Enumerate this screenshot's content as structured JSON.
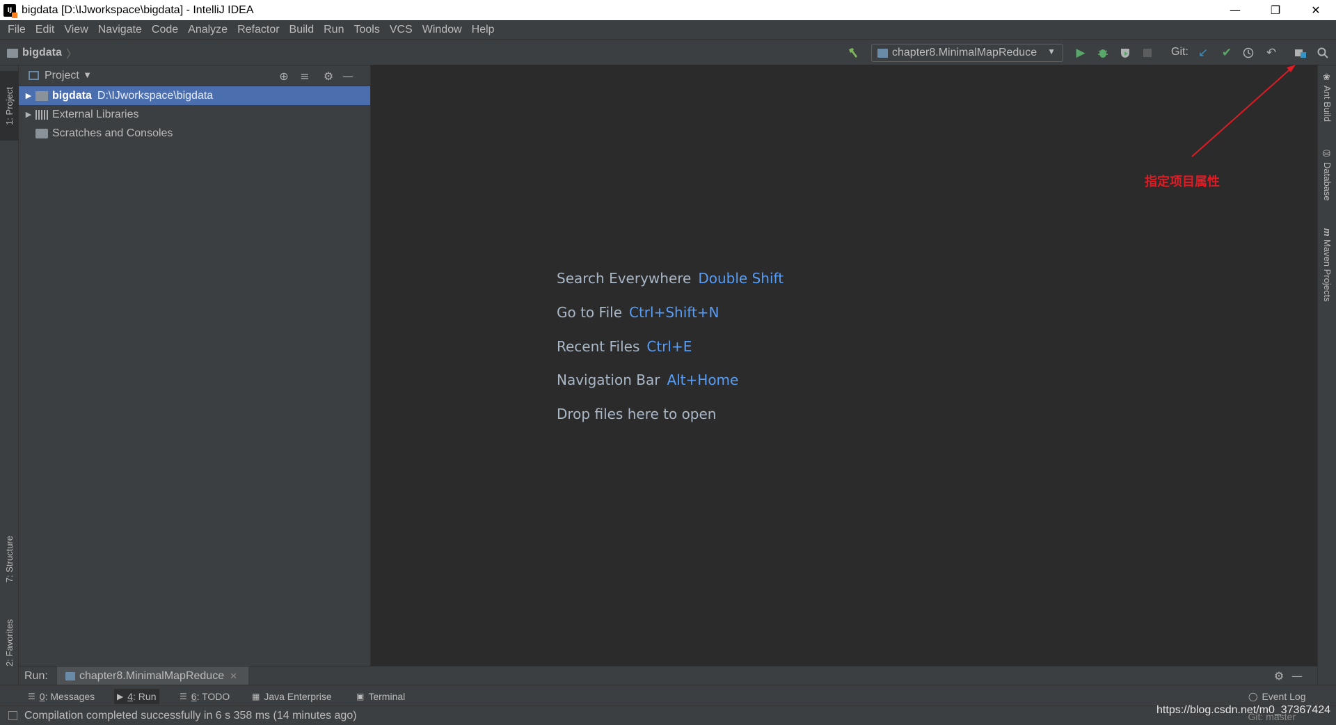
{
  "window": {
    "title": "bigdata [D:\\IJworkspace\\bigdata] - IntelliJ IDEA",
    "app_icon": "intellij-icon",
    "controls": [
      "minimize",
      "restore",
      "close"
    ]
  },
  "menu": [
    {
      "label": "File"
    },
    {
      "label": "Edit"
    },
    {
      "label": "View"
    },
    {
      "label": "Navigate"
    },
    {
      "label": "Code"
    },
    {
      "label": "Analyze"
    },
    {
      "label": "Refactor"
    },
    {
      "label": "Build"
    },
    {
      "label": "Run"
    },
    {
      "label": "Tools"
    },
    {
      "label": "VCS"
    },
    {
      "label": "Window"
    },
    {
      "label": "Help"
    }
  ],
  "navbar": {
    "breadcrumb": "bigdata",
    "run_config": "chapter8.MinimalMapReduce",
    "git_label": "Git:"
  },
  "left_stripe": {
    "project_tab": "1: Project",
    "structure_tab": "7: Structure",
    "favorites_tab": "2: Favorites"
  },
  "right_stripe": {
    "ant_tab": "Ant Build",
    "database_tab": "Database",
    "maven_tab": "Maven Projects"
  },
  "project_panel": {
    "title": "Project",
    "tree": [
      {
        "label": "bigdata",
        "path": "D:\\IJworkspace\\bigdata",
        "selected": true
      },
      {
        "label": "External Libraries"
      },
      {
        "label": "Scratches and Consoles"
      }
    ]
  },
  "editor": {
    "hints": [
      {
        "text": "Search Everywhere",
        "key": "Double Shift"
      },
      {
        "text": "Go to File",
        "key": "Ctrl+Shift+N"
      },
      {
        "text": "Recent Files",
        "key": "Ctrl+E"
      },
      {
        "text": "Navigation Bar",
        "key": "Alt+Home"
      },
      {
        "text": "Drop files here to open",
        "key": ""
      }
    ]
  },
  "annotation": {
    "text": "指定项目属性",
    "color": "#e01b24"
  },
  "run_panel": {
    "label": "Run:",
    "tab": "chapter8.MinimalMapReduce"
  },
  "bottom_tabs": [
    {
      "num": "0",
      "rest": ": Messages"
    },
    {
      "num": "4",
      "rest": ": Run"
    },
    {
      "num": "6",
      "rest": ": TODO"
    },
    {
      "num": "",
      "rest": "Java Enterprise"
    },
    {
      "num": "",
      "rest": "Terminal"
    }
  ],
  "event_log": "Event Log",
  "status": {
    "message": "Compilation completed successfully in 6 s 358 ms (14 minutes ago)",
    "git_branch": "Git: master"
  },
  "watermark": "https://blog.csdn.net/m0_37367424"
}
